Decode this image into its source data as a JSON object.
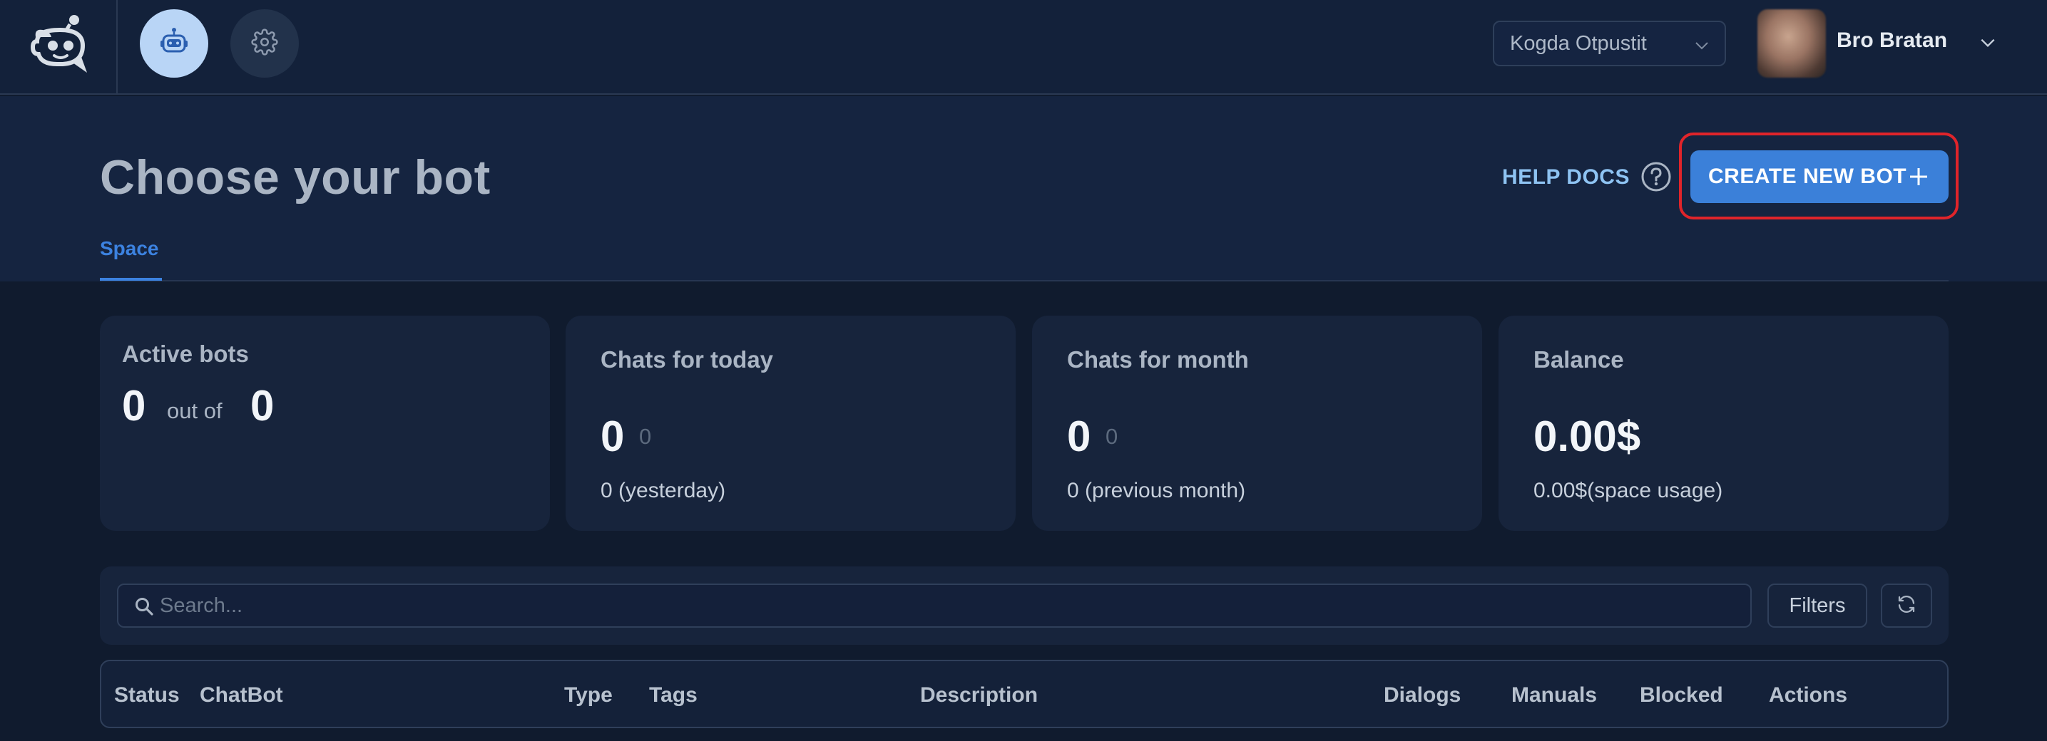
{
  "app": {
    "workspace": "Kogda Otpustit",
    "user_name": "Bro Bratan"
  },
  "header": {
    "title": "Choose your bot",
    "help_docs": "HELP DOCS",
    "create_button": "CREATE NEW BOT",
    "tabs": [
      {
        "label": "Space",
        "active": true
      }
    ]
  },
  "stats": {
    "active_bots": {
      "title": "Active bots",
      "value": "0",
      "separator": "out of",
      "total": "0"
    },
    "chats_today": {
      "title": "Chats for today",
      "value": "0",
      "delta": "0",
      "sub": "0 (yesterday)"
    },
    "chats_month": {
      "title": "Chats for month",
      "value": "0",
      "delta": "0",
      "sub": "0 (previous month)"
    },
    "balance": {
      "title": "Balance",
      "value": "0.00$",
      "sub": "0.00$(space usage)"
    }
  },
  "search": {
    "placeholder": "Search...",
    "filters_label": "Filters"
  },
  "table": {
    "columns": [
      "Status",
      "ChatBot",
      "Type",
      "Tags",
      "Description",
      "Dialogs",
      "Manuals",
      "Blocked",
      "Actions"
    ]
  },
  "colors": {
    "accent": "#3b80d9",
    "highlight": "#e0242a",
    "background": "#101b2e"
  },
  "icons": [
    "app-logo-icon",
    "robot-icon",
    "gear-icon",
    "chevron-down-icon",
    "help-circle-icon",
    "plus-icon",
    "search-icon",
    "refresh-icon"
  ]
}
